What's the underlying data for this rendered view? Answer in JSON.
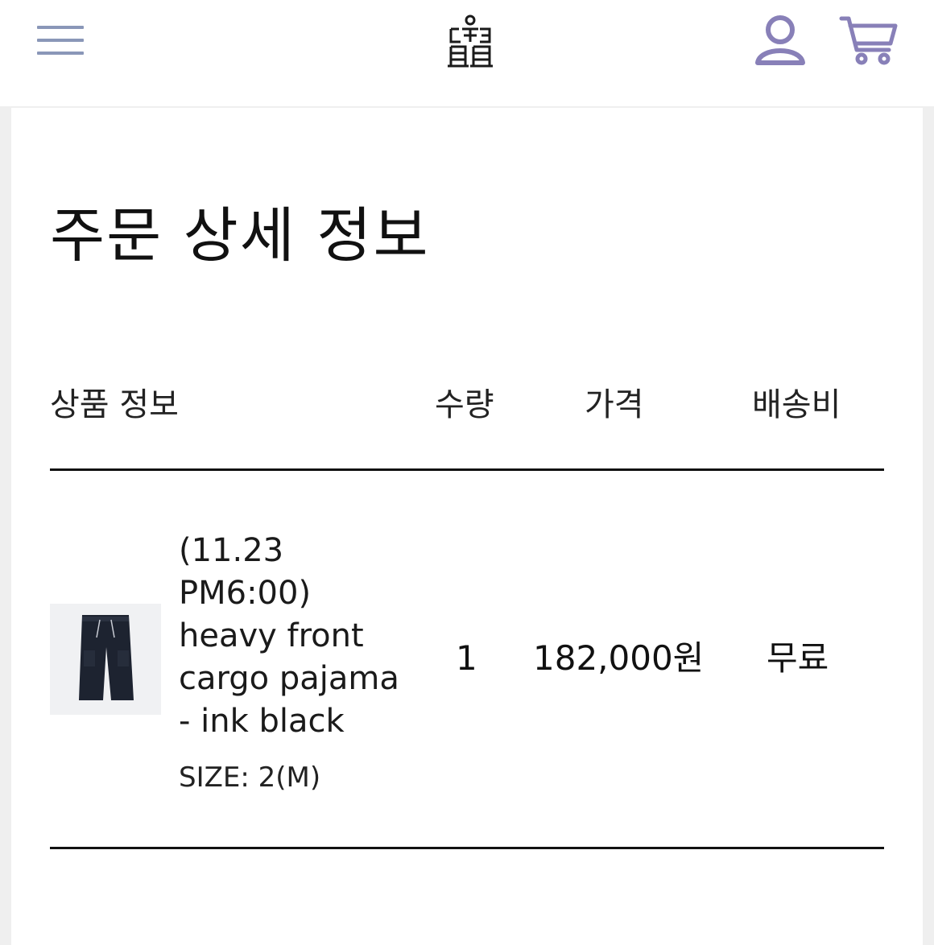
{
  "header": {
    "menu_icon": "hamburger-menu-icon",
    "logo_icon": "brand-logo-icon",
    "user_icon": "user-icon",
    "cart_icon": "shopping-cart-icon",
    "icon_color": "#8a97b8",
    "user_cart_color": "#8880b8"
  },
  "page": {
    "title": "주문 상세 정보"
  },
  "table": {
    "headers": {
      "product": "상품 정보",
      "quantity": "수량",
      "price": "가격",
      "shipping": "배송비"
    },
    "rows": [
      {
        "product_name": "(11.23 PM6:00) heavy front cargo pajama - ink black",
        "option": "SIZE: 2(M)",
        "quantity": "1",
        "price": "182,000원",
        "shipping": "무료"
      }
    ]
  }
}
